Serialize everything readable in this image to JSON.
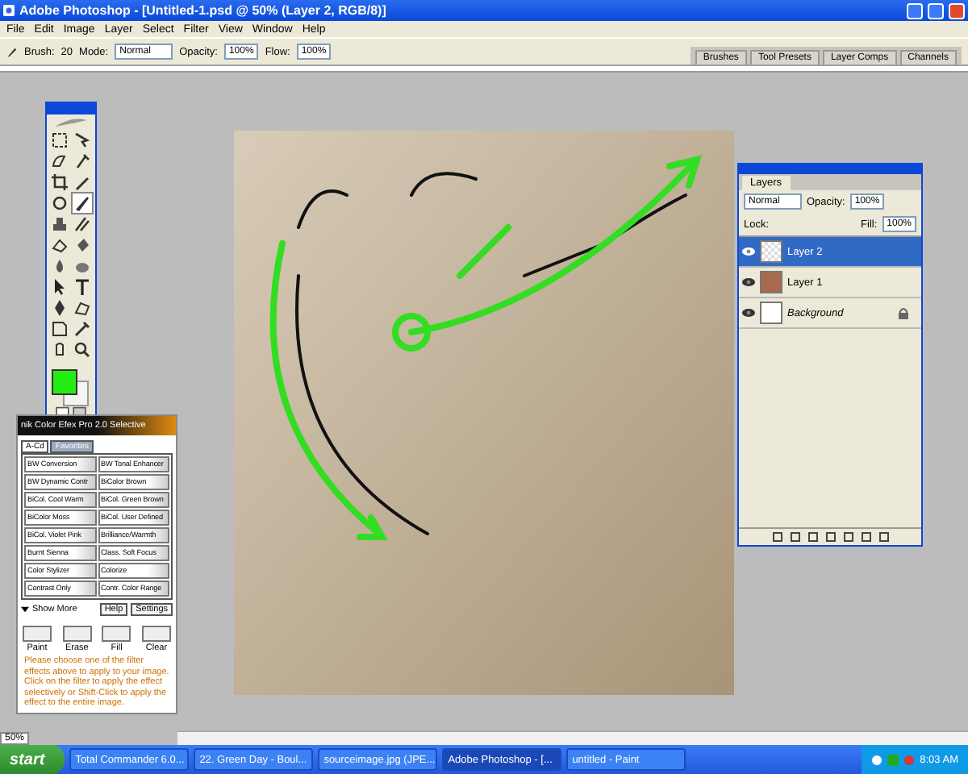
{
  "window": {
    "title": "Adobe Photoshop - [Untitled-1.psd @ 50% (Layer 2, RGB/8)]"
  },
  "menu": [
    "File",
    "Edit",
    "Image",
    "Layer",
    "Select",
    "Filter",
    "View",
    "Window",
    "Help"
  ],
  "options": {
    "brush_label": "Brush:",
    "brush_size": "20",
    "mode_label": "Mode:",
    "mode": "Normal",
    "opacity_label": "Opacity:",
    "opacity": "100%",
    "flow_label": "Flow:",
    "flow": "100%"
  },
  "palette_well": [
    "Brushes",
    "Tool Presets",
    "Layer Comps",
    "Channels"
  ],
  "tools": [
    {
      "selected": false
    },
    {
      "selected": false
    },
    {
      "selected": false
    },
    {
      "selected": false
    },
    {
      "selected": false
    },
    {
      "selected": false
    },
    {
      "selected": false
    },
    {
      "selected": true
    },
    {
      "selected": false
    },
    {
      "selected": false
    },
    {
      "selected": false
    },
    {
      "selected": false
    },
    {
      "selected": false
    },
    {
      "selected": false
    },
    {
      "selected": false
    },
    {
      "selected": false
    },
    {
      "selected": false
    },
    {
      "selected": false
    },
    {
      "selected": false
    },
    {
      "selected": false
    },
    {
      "selected": false
    },
    {
      "selected": false
    }
  ],
  "layers": {
    "tab": "Layers",
    "blend": "Normal",
    "opacity_label": "Opacity:",
    "opacity": "100%",
    "lock_label": "Lock:",
    "fill_label": "Fill:",
    "fill": "100%",
    "items": [
      {
        "name": "Layer 2",
        "kind": "transparent",
        "selected": true,
        "visible": true,
        "locked": false
      },
      {
        "name": "Layer 1",
        "kind": "photo",
        "selected": false,
        "visible": true,
        "locked": false
      },
      {
        "name": "Background",
        "kind": "white",
        "selected": false,
        "visible": true,
        "locked": true
      }
    ]
  },
  "nik": {
    "title": "nik Color Efex Pro 2.0 Selective",
    "tabs": [
      {
        "label": "A-Cd",
        "selected": true
      },
      {
        "label": "Favorites",
        "selected": false
      }
    ],
    "filters": [
      "BW Conversion",
      "BW Tonal Enhancer",
      "BW Dynamic Contr",
      "BiColor Brown",
      "BiCol. Cool Warm",
      "BiCol. Green Brown",
      "BiColor Moss",
      "BiCol. User Defined",
      "BiCol. Violet Pink",
      "Brilliance/Warmth",
      "Burnt Sienna",
      "Class. Soft Focus",
      "Color Stylizer",
      "Colorize",
      "Contrast Only",
      "Contr. Color Range"
    ],
    "show_more": "Show More",
    "help": "Help",
    "settings": "Settings",
    "actions": [
      "Paint",
      "Erase",
      "Fill",
      "Clear"
    ],
    "message": "Please choose one of the filter effects above to apply to your image. Click on the filter to apply the effect selectively or Shift-Click to apply the effect to the entire image."
  },
  "status": {
    "zoom": "50%"
  },
  "taskbar": {
    "start": "start",
    "items": [
      {
        "label": "Total Commander 6.0...",
        "selected": false
      },
      {
        "label": "22. Green Day - Boul...",
        "selected": false
      },
      {
        "label": "sourceimage.jpg (JPE...",
        "selected": false
      },
      {
        "label": "Adobe Photoshop - [...",
        "selected": true
      },
      {
        "label": "untitled - Paint",
        "selected": false
      }
    ],
    "clock": "8:03 AM"
  }
}
